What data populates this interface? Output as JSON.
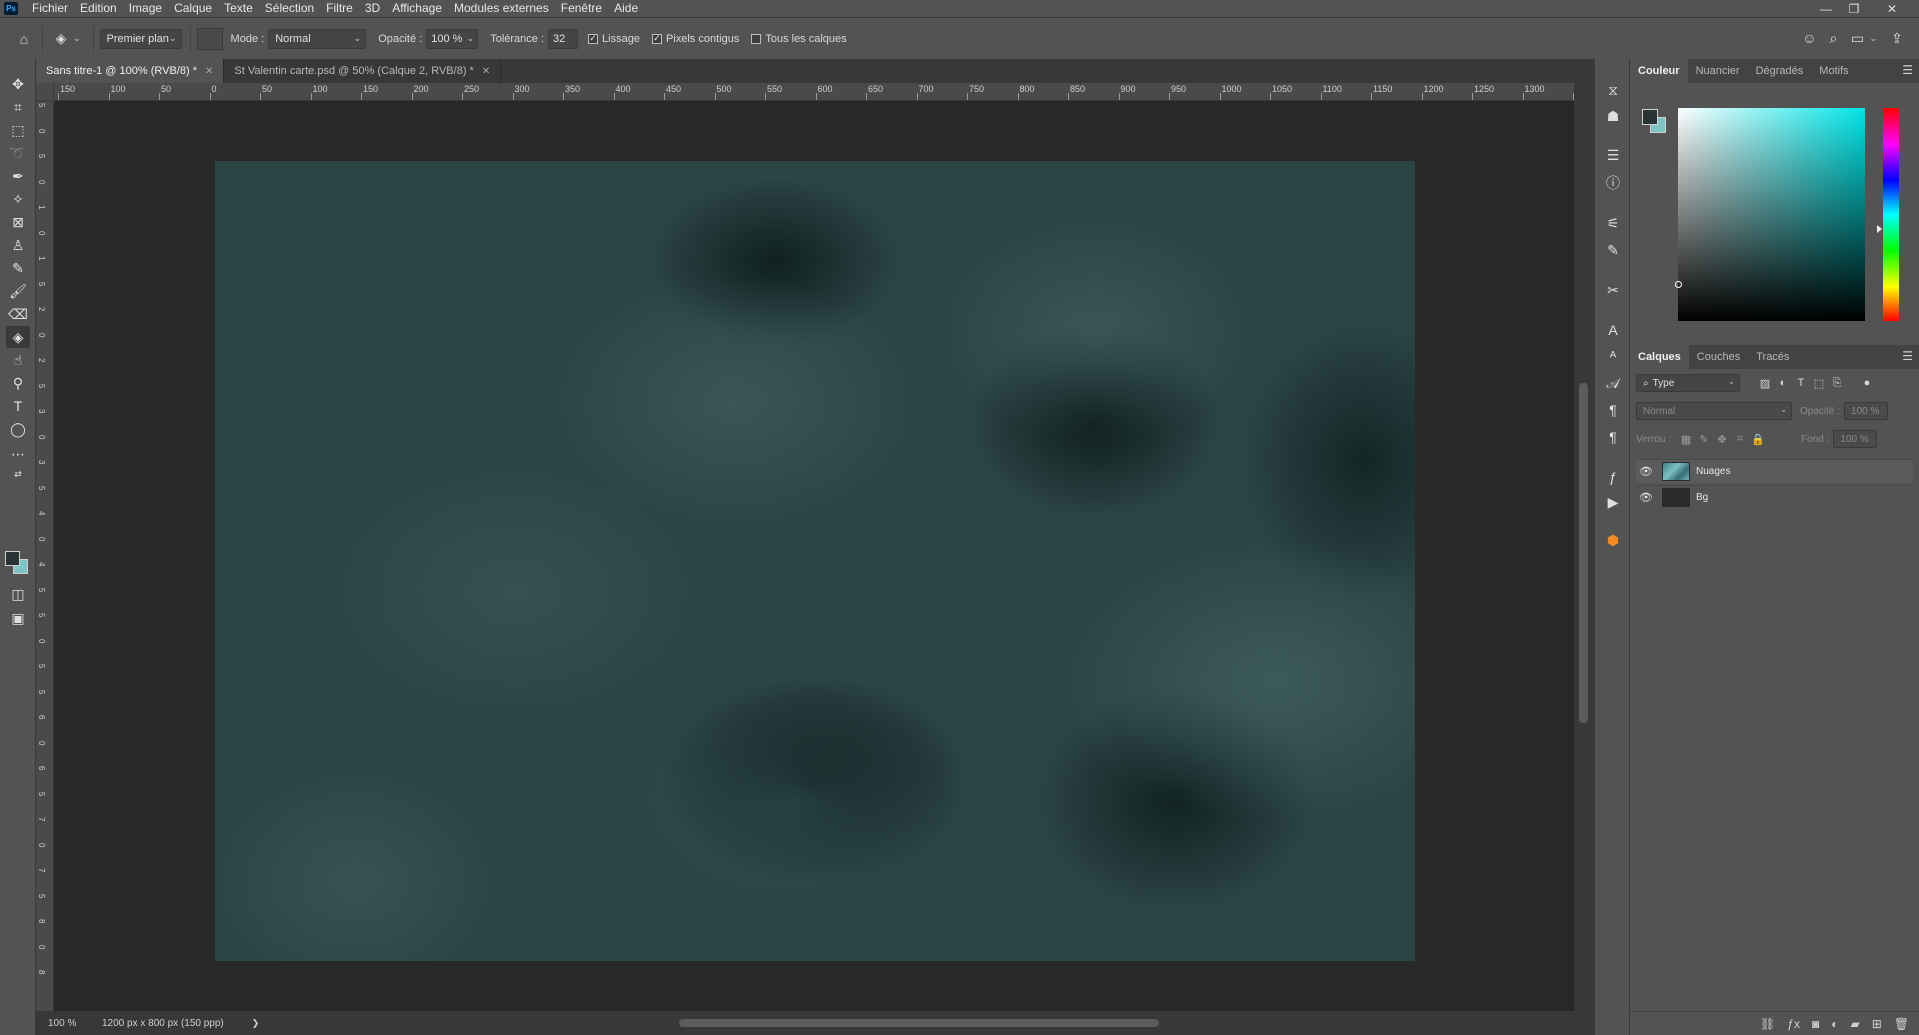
{
  "app": {
    "logo": "Ps"
  },
  "menu": [
    "Fichier",
    "Edition",
    "Image",
    "Calque",
    "Texte",
    "Sélection",
    "Filtre",
    "3D",
    "Affichage",
    "Modules externes",
    "Fenêtre",
    "Aide"
  ],
  "window_controls": {
    "minimize": "—",
    "restore": "❐",
    "close": "✕"
  },
  "options": {
    "fill_source": "Premier plan",
    "mode_label": "Mode :",
    "mode_value": "Normal",
    "opacity_label": "Opacité :",
    "opacity_value": "100 %",
    "tolerance_label": "Tolérance :",
    "tolerance_value": "32",
    "antialias_label": "Lissage",
    "antialias_checked": true,
    "contiguous_label": "Pixels contigus",
    "contiguous_checked": true,
    "all_layers_label": "Tous les calques",
    "all_layers_checked": false
  },
  "tabs": [
    {
      "label": "Sans titre-1 @ 100% (RVB/8) *",
      "active": true
    },
    {
      "label": "St Valentin carte.psd @ 50% (Calque 2, RVB/8) *",
      "active": false
    }
  ],
  "ruler_h": [
    "150",
    "100",
    "50",
    "0",
    "50",
    "100",
    "150",
    "200",
    "250",
    "300",
    "350",
    "400",
    "450",
    "500",
    "550",
    "600",
    "650",
    "700",
    "750",
    "800",
    "850",
    "900",
    "950",
    "1000",
    "1050",
    "1100",
    "1150",
    "1200",
    "1250",
    "1300",
    "13"
  ],
  "ruler_v": [
    "5",
    "0",
    "5",
    "0",
    "1",
    "0",
    "1",
    "5",
    "2",
    "0",
    "2",
    "5",
    "3",
    "0",
    "3",
    "5",
    "4",
    "0",
    "4",
    "5",
    "5",
    "0",
    "5",
    "5",
    "6",
    "0",
    "6",
    "5",
    "7",
    "0",
    "7",
    "5",
    "8",
    "0",
    "8"
  ],
  "status": {
    "zoom": "100 %",
    "doc_info": "1200 px x 800 px (150 ppp)",
    "arrow": "❯"
  },
  "color_panel": {
    "tabs": [
      "Couleur",
      "Nuancier",
      "Dégradés",
      "Motifs"
    ],
    "foreground": "#283434",
    "background": "#7ec4c6"
  },
  "layers_panel": {
    "tabs": [
      "Calques",
      "Couches",
      "Tracés"
    ],
    "filter": "Type",
    "blend_mode": "Normal",
    "opacity_label": "Opacité :",
    "opacity_value": "100 %",
    "lock_label": "Verrou :",
    "fill_label": "Fond :",
    "fill_value": "100 %",
    "layers": [
      {
        "name": "Nuages",
        "visible": true,
        "selected": true
      },
      {
        "name": "Bg",
        "visible": true,
        "selected": false
      }
    ]
  }
}
